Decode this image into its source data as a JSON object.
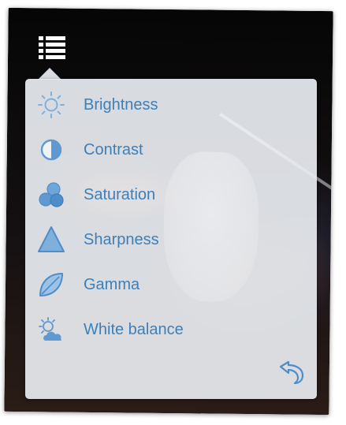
{
  "colors": {
    "accent": "#3f7fb8",
    "icon_fill": "#7fb0dc",
    "panel_bg": "#e8ecf0",
    "video_bg": "#0b0a0a"
  },
  "menu_button": {
    "icon": "list-icon"
  },
  "panel": {
    "items": [
      {
        "label": "Brightness",
        "icon": "sun-icon"
      },
      {
        "label": "Contrast",
        "icon": "contrast-icon"
      },
      {
        "label": "Saturation",
        "icon": "saturation-icon"
      },
      {
        "label": "Sharpness",
        "icon": "triangle-icon"
      },
      {
        "label": "Gamma",
        "icon": "leaf-icon"
      },
      {
        "label": "White balance",
        "icon": "weather-icon"
      }
    ],
    "reset": {
      "icon": "undo-icon"
    }
  }
}
